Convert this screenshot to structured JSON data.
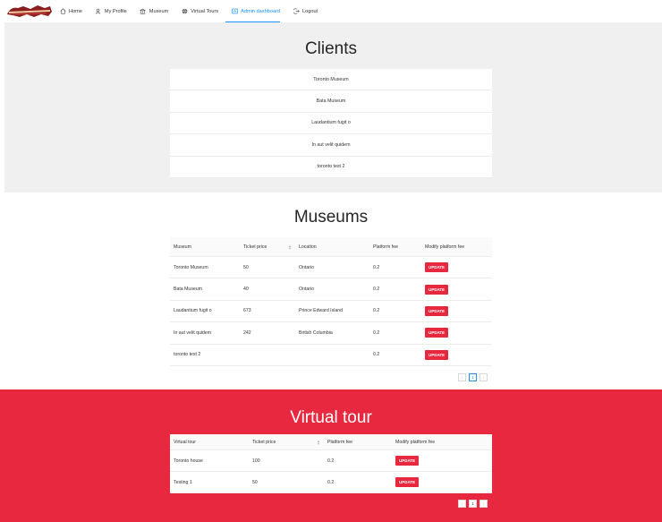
{
  "nav": {
    "items": [
      {
        "label": "Home",
        "icon": "home-icon"
      },
      {
        "label": "My Profile",
        "icon": "user-icon"
      },
      {
        "label": "Museum",
        "icon": "bank-icon"
      },
      {
        "label": "Virtual Tours",
        "icon": "globe-icon"
      },
      {
        "label": "Admin dashboard",
        "icon": "dashboard-icon"
      },
      {
        "label": "Logout",
        "icon": "logout-icon"
      }
    ],
    "active_color": "#1890ff"
  },
  "clients": {
    "title": "Clients",
    "items": [
      "Toronto Museum",
      "Bata Museum",
      "Laudantium fugit o",
      "In aut velit quidem",
      "toronto test 2"
    ]
  },
  "museums": {
    "title": "Museums",
    "headers": [
      "Museum",
      "Ticket price",
      "Location",
      "Platform fee",
      "Modify platform fee"
    ],
    "rows": [
      {
        "museum": "Toronto Museum",
        "price": "50",
        "location": "Ontario",
        "fee": "0.2",
        "action": "UPDATE"
      },
      {
        "museum": "Bata Museum",
        "price": "40",
        "location": "Ontario",
        "fee": "0.2",
        "action": "UPDATE"
      },
      {
        "museum": "Laudantium fugit o",
        "price": "673",
        "location": "Prince Edward Island",
        "fee": "0.2",
        "action": "UPDATE"
      },
      {
        "museum": "In aut velit quidem",
        "price": "242",
        "location": "British Columbia",
        "fee": "0.2",
        "action": "UPDATE"
      },
      {
        "museum": "toronto test 2",
        "price": "",
        "location": "",
        "fee": "0.2",
        "action": "UPDATE"
      }
    ],
    "pagination": {
      "prev": "‹",
      "current": "1",
      "next": "›"
    }
  },
  "virtual_tours": {
    "title": "Virtual tour",
    "headers": [
      "Virtual tour",
      "Ticket price",
      "Platform fee",
      "Modify platform fee"
    ],
    "rows": [
      {
        "tour": "Toronto house",
        "price": "100",
        "fee": "0.2",
        "action": "UPDATE"
      },
      {
        "tour": "Testing 1",
        "price": "50",
        "fee": "0.2",
        "action": "UPDATE"
      }
    ],
    "pagination": {
      "prev": "‹",
      "current": "1",
      "next": "›"
    },
    "section_color": "#e8283f"
  }
}
